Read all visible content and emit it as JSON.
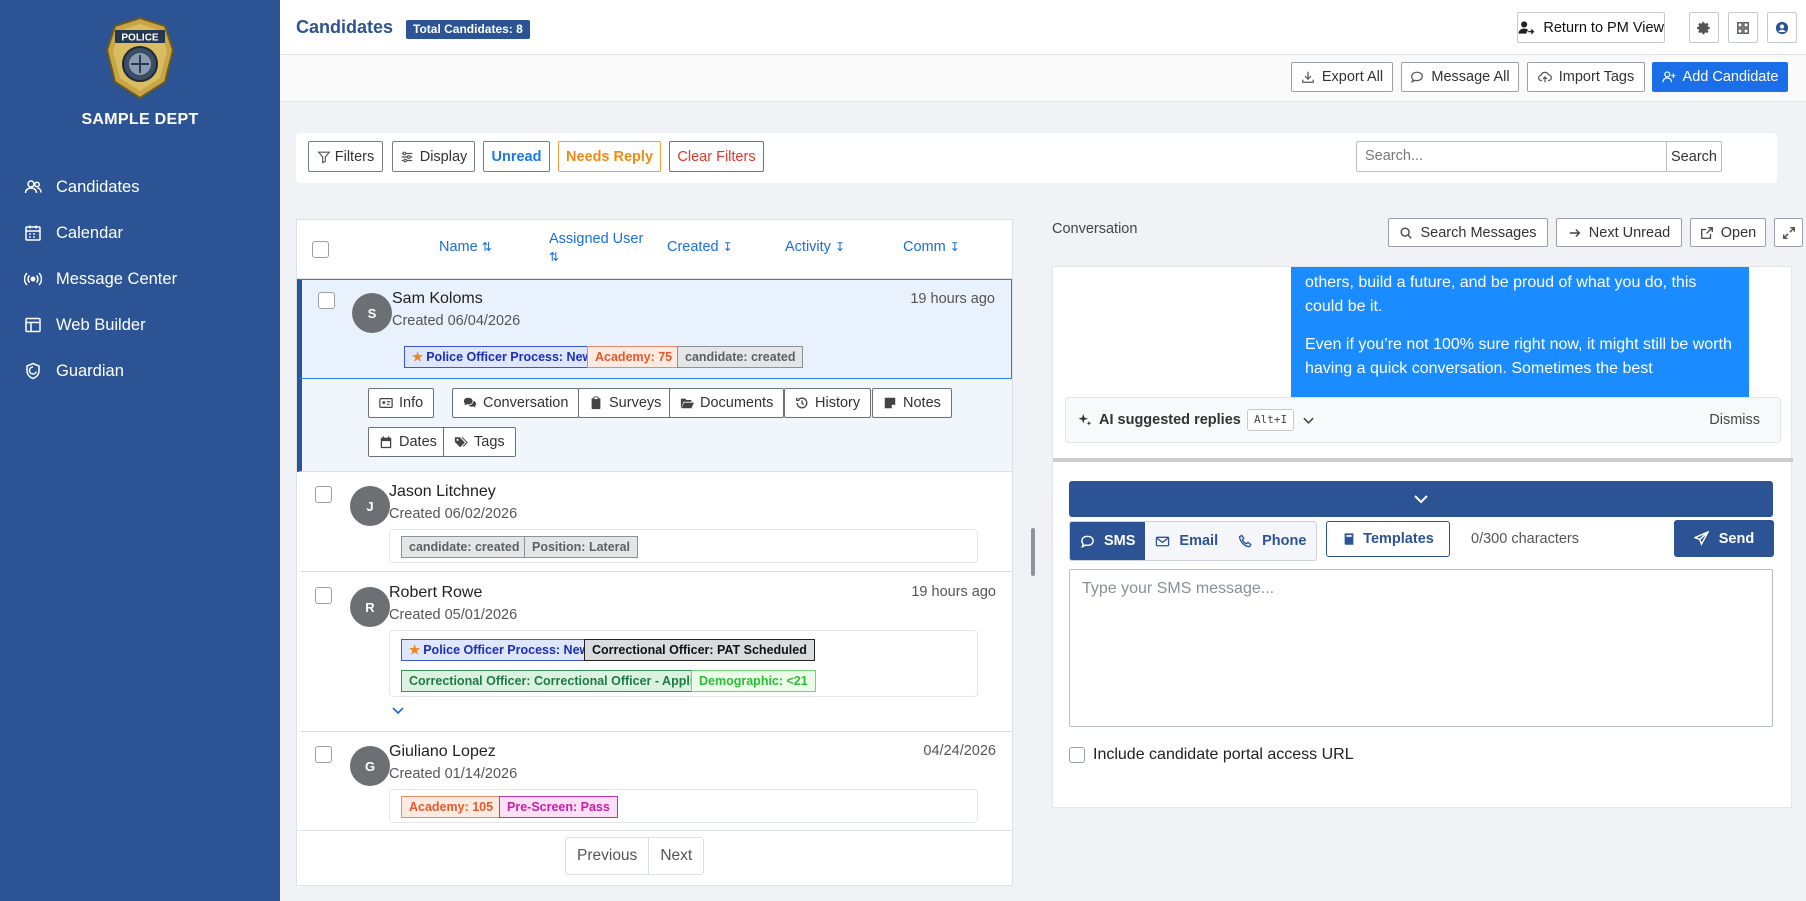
{
  "sidebar": {
    "dept_name": "SAMPLE DEPT",
    "nav": [
      {
        "label": "Candidates",
        "icon": "users-icon"
      },
      {
        "label": "Calendar",
        "icon": "calendar-icon"
      },
      {
        "label": "Message Center",
        "icon": "broadcast-icon"
      },
      {
        "label": "Web Builder",
        "icon": "layout-icon"
      },
      {
        "label": "Guardian",
        "icon": "shield-icon"
      }
    ]
  },
  "header": {
    "title": "Candidates",
    "total_badge": "Total Candidates: 8",
    "return_label": "Return to PM View"
  },
  "actions": {
    "export": "Export All",
    "message": "Message All",
    "import": "Import Tags",
    "add": "Add Candidate"
  },
  "filters": {
    "filters": "Filters",
    "display": "Display",
    "unread": "Unread",
    "needs_reply": "Needs Reply",
    "clear": "Clear Filters",
    "search_placeholder": "Search...",
    "search_button": "Search"
  },
  "columns": {
    "name": "Name",
    "assigned": "Assigned User",
    "created": "Created",
    "activity": "Activity",
    "comm": "Comm"
  },
  "candidates": [
    {
      "initial": "S",
      "name": "Sam Koloms",
      "created": "Created 06/04/2026",
      "time": "19 hours ago",
      "tags": [
        "Police Officer Process: New",
        "Academy: 75",
        "candidate: created"
      ]
    },
    {
      "initial": "J",
      "name": "Jason Litchney",
      "created": "Created 06/02/2026",
      "time": "",
      "tags": [
        "candidate: created",
        "Position: Lateral"
      ]
    },
    {
      "initial": "R",
      "name": "Robert Rowe",
      "created": "Created 05/01/2026",
      "time": "19 hours ago",
      "tags": [
        "Police Officer Process: New",
        "Correctional Officer: PAT Scheduled",
        "Correctional Officer: Correctional Officer - Applied",
        "Demographic: <21"
      ]
    },
    {
      "initial": "G",
      "name": "Giuliano Lopez",
      "created": "Created 01/14/2026",
      "time": "04/24/2026",
      "tags": [
        "Academy: 105",
        "Pre-Screen: Pass"
      ]
    }
  ],
  "row_tabs": [
    "Info",
    "Conversation",
    "Surveys",
    "Documents",
    "History",
    "Notes",
    "Dates",
    "Tags"
  ],
  "pager": {
    "prev": "Previous",
    "next": "Next"
  },
  "conversation": {
    "label": "Conversation",
    "search_messages": "Search Messages",
    "next_unread": "Next Unread",
    "open": "Open",
    "message_line1": "others, build a future, and be proud of what you do, this could be it.",
    "message_line2": "Even if you’re not 100% sure right now, it might still be worth having a quick conversation. Sometimes the best",
    "ai_label": "AI suggested replies",
    "ai_shortcut": "Alt+I",
    "dismiss": "Dismiss",
    "channels": {
      "sms": "SMS",
      "email": "Email",
      "phone": "Phone"
    },
    "templates": "Templates",
    "char_count": "0/300 characters",
    "send": "Send",
    "sms_placeholder": "Type your SMS message...",
    "portal_label": "Include candidate portal access URL"
  },
  "colors": {
    "primary": "#2c5394",
    "accent": "#1a8cff",
    "sidebar": "#2c5394"
  }
}
